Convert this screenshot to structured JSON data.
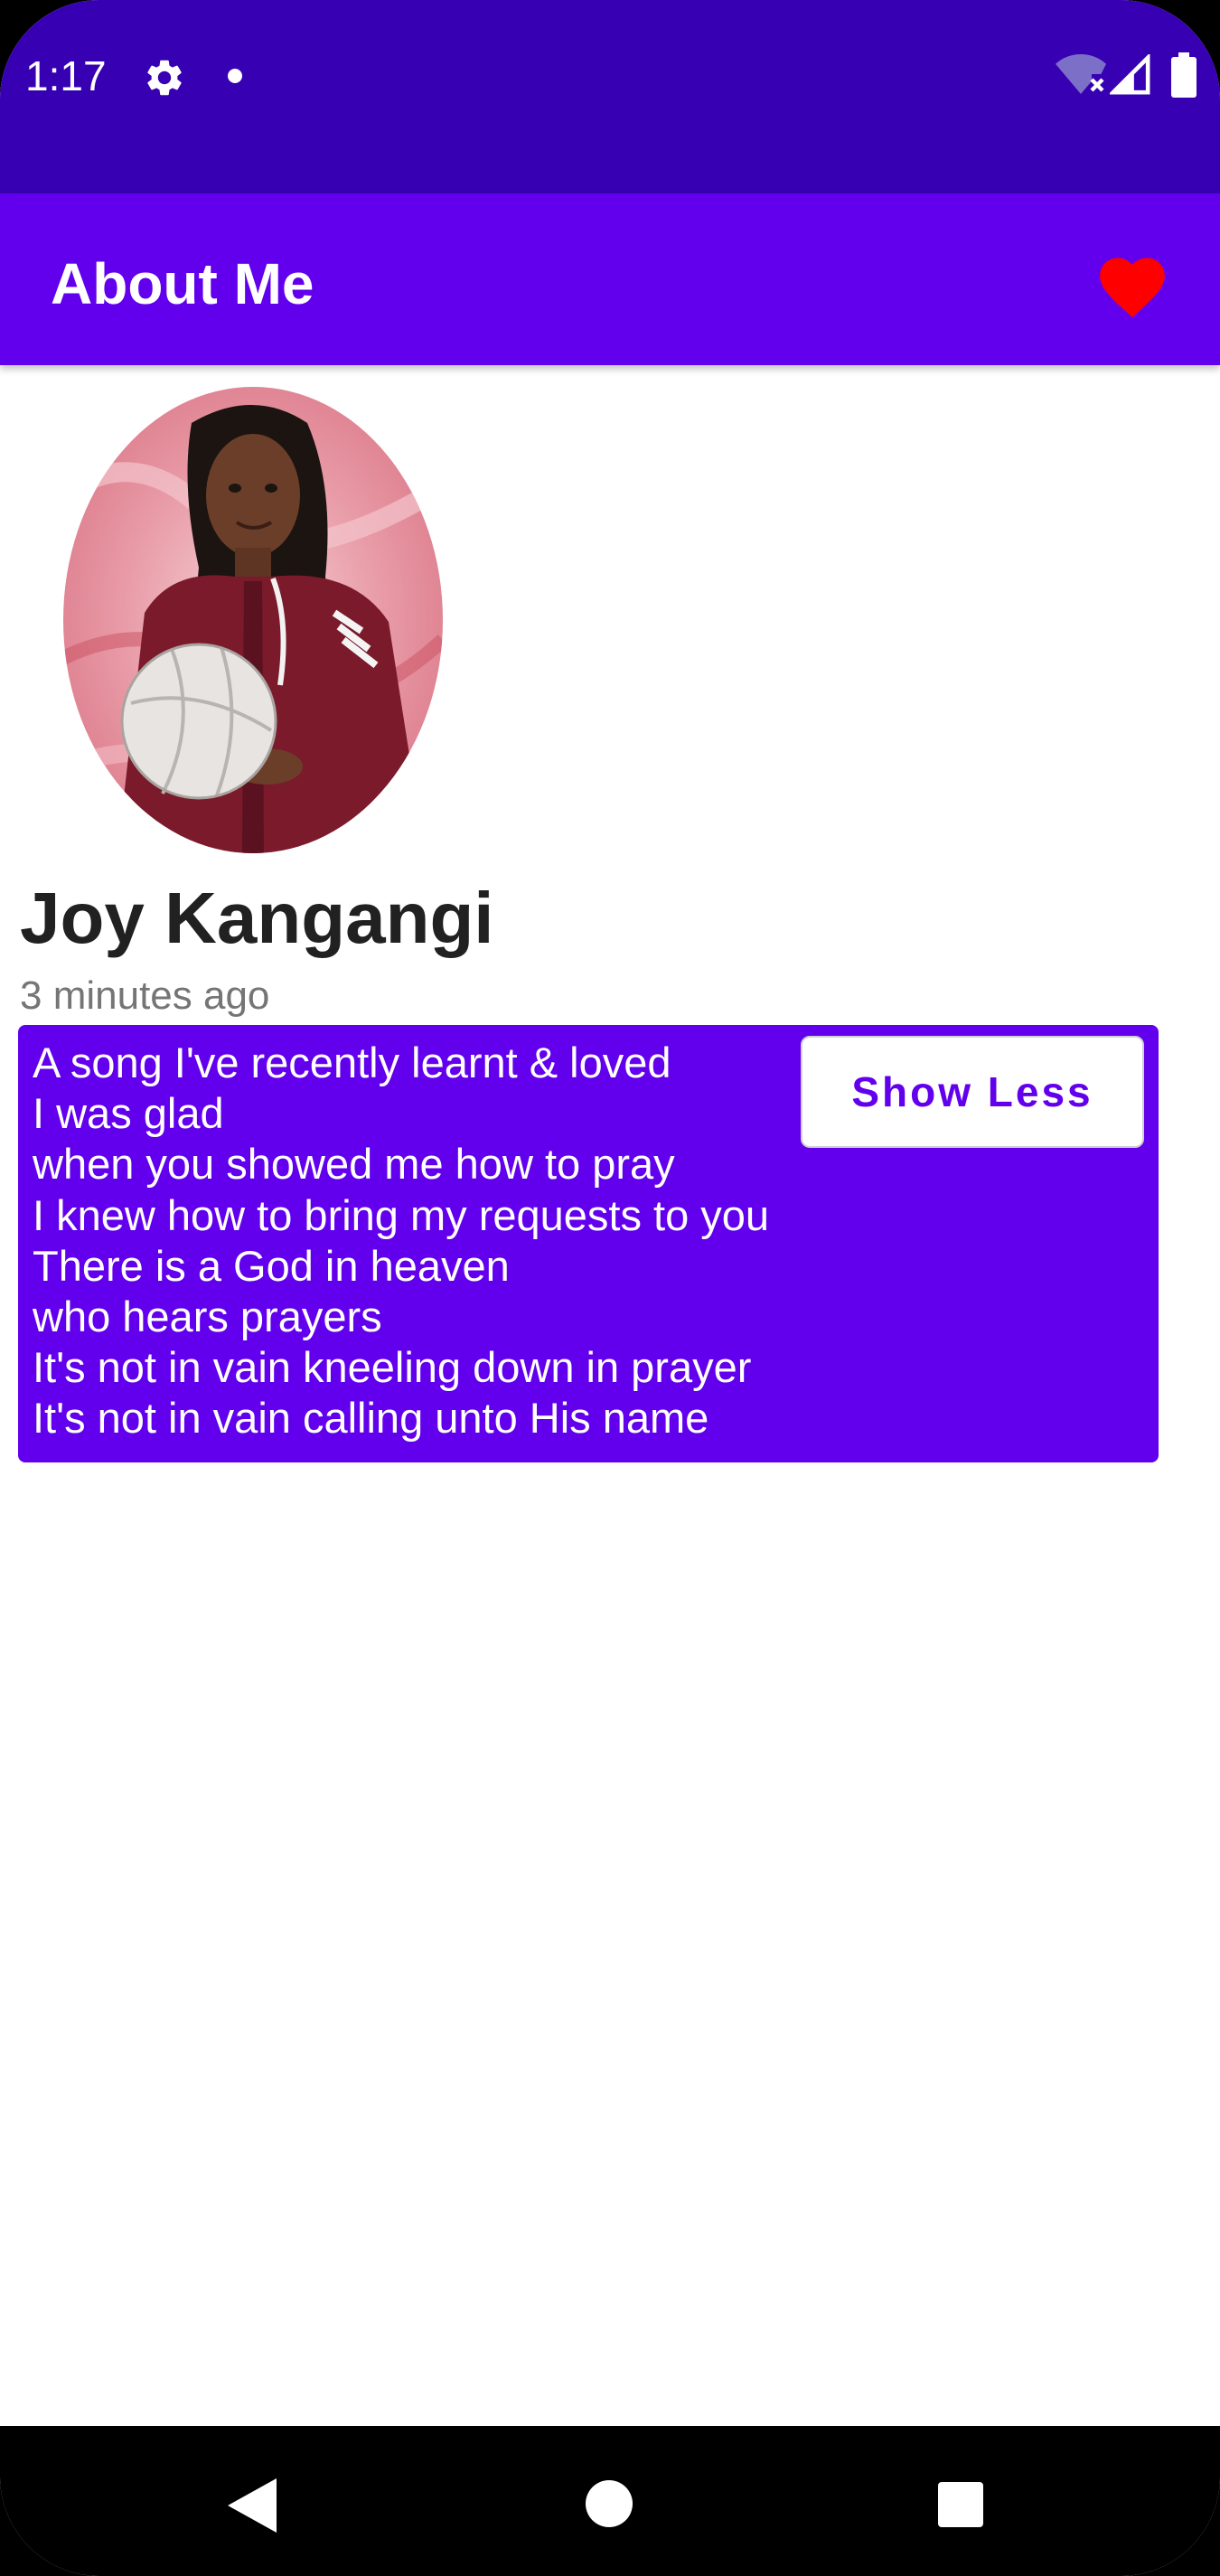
{
  "status_bar": {
    "time": "1:17",
    "icons": [
      "gear-icon",
      "notification-dot-icon",
      "wifi-no-internet-icon",
      "cell-signal-icon",
      "battery-icon"
    ]
  },
  "app_bar": {
    "title": "About Me",
    "favorite_icon": "heart-icon",
    "accent_color": "#6200ee",
    "heart_color": "#ff0000"
  },
  "profile": {
    "name": "Joy Kangangi",
    "time_ago": "3 minutes ago",
    "photo_description": "profile-photo"
  },
  "post": {
    "lines": [
      "A song I've recently learnt & loved",
      "I was glad",
      "when you showed me how to pray",
      "I knew how to bring my requests to you",
      "There is a God in heaven",
      "who hears prayers",
      "It's not in vain kneeling down in prayer",
      "It's not in vain calling unto His name"
    ],
    "toggle_label": "Show Less"
  },
  "nav_bar": {
    "icons": [
      "back-icon",
      "home-icon",
      "recents-icon"
    ]
  }
}
